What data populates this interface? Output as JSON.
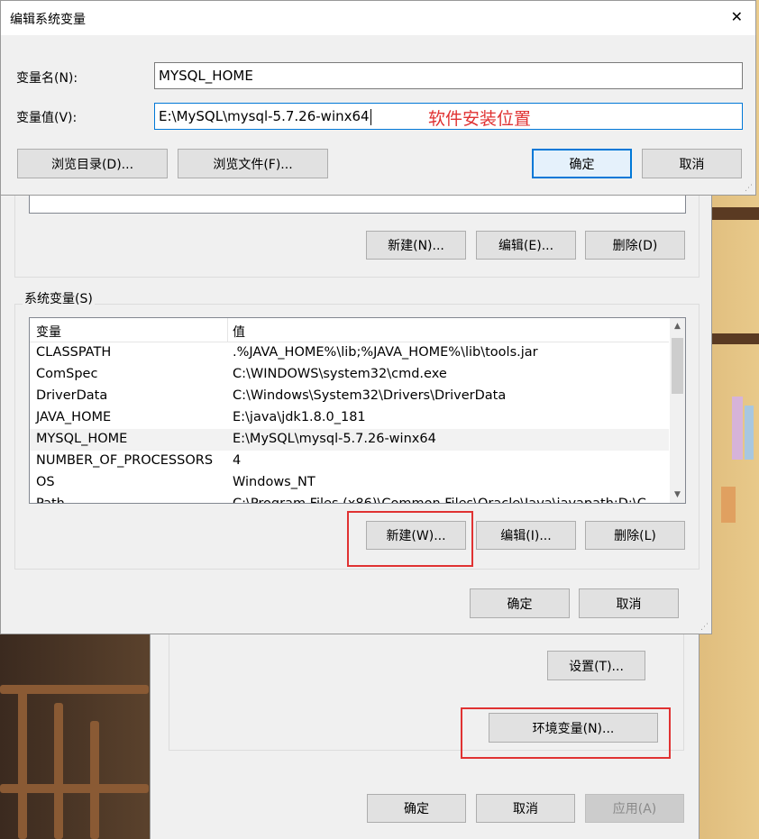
{
  "edit_dialog": {
    "title": "编辑系统变量",
    "close_glyph": "✕",
    "var_name_label": "变量名(N):",
    "var_name_value": "MYSQL_HOME",
    "var_value_label": "变量值(V):",
    "var_value_value": "E:\\MySQL\\mysql-5.7.26-winx64",
    "annotation": "软件安装位置",
    "browse_dir_button": "浏览目录(D)...",
    "browse_file_button": "浏览文件(F)...",
    "ok_button": "确定",
    "cancel_button": "取消"
  },
  "env_dialog": {
    "user_vars_buttons": {
      "new": "新建(N)...",
      "edit": "编辑(E)...",
      "delete": "删除(D)"
    },
    "system_vars_label": "系统变量(S)",
    "columns": [
      "变量",
      "值"
    ],
    "rows": [
      {
        "name": "CLASSPATH",
        "value": ".%JAVA_HOME%\\lib;%JAVA_HOME%\\lib\\tools.jar"
      },
      {
        "name": "ComSpec",
        "value": "C:\\WINDOWS\\system32\\cmd.exe"
      },
      {
        "name": "DriverData",
        "value": "C:\\Windows\\System32\\Drivers\\DriverData"
      },
      {
        "name": "JAVA_HOME",
        "value": "E:\\java\\jdk1.8.0_181"
      },
      {
        "name": "MYSQL_HOME",
        "value": "E:\\MySQL\\mysql-5.7.26-winx64"
      },
      {
        "name": "NUMBER_OF_PROCESSORS",
        "value": "4"
      },
      {
        "name": "OS",
        "value": "Windows_NT"
      },
      {
        "name": "Path",
        "value": "C:\\Program Files (x86)\\Common Files\\Oracle\\Java\\javapath;D:\\C..."
      }
    ],
    "selected_row": "MYSQL_HOME",
    "system_vars_buttons": {
      "new": "新建(W)...",
      "edit": "编辑(I)...",
      "delete": "删除(L)"
    },
    "ok_button": "确定",
    "cancel_button": "取消"
  },
  "sys_props_dialog": {
    "settings_button": "设置(T)...",
    "env_vars_button": "环境变量(N)...",
    "ok_button": "确定",
    "cancel_button": "取消",
    "apply_button": "应用(A)"
  },
  "colors": {
    "annotation_red": "#e03232",
    "focus_blue": "#0078d7"
  }
}
